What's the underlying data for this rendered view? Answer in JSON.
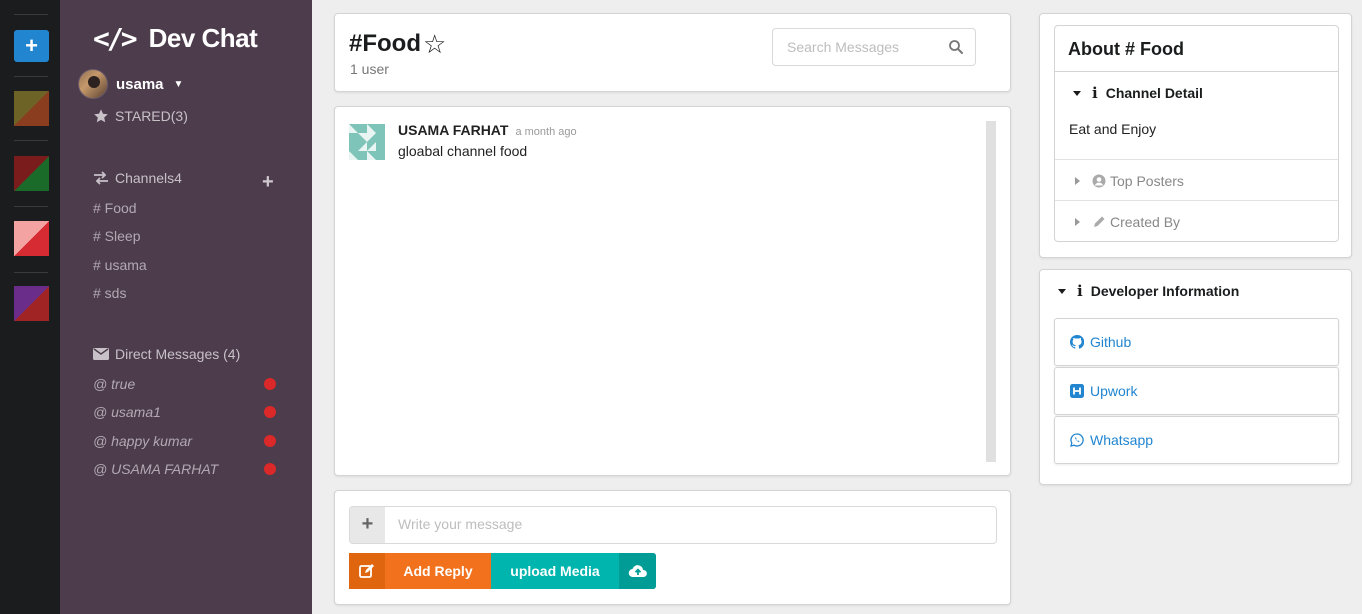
{
  "app": {
    "brand_code": "</>",
    "brand_name": "Dev Chat"
  },
  "rail": {
    "add_label": "+"
  },
  "user": {
    "name": "usama"
  },
  "sidebar": {
    "starred_label": "STARED(3)",
    "channels_label": "Channels4",
    "channels": [
      "# Food",
      "# Sleep",
      "# usama",
      "# sds"
    ],
    "direct_label": "Direct Messages (4)",
    "direct_messages": [
      "@ true",
      "@ usama1",
      "@ happy kumar",
      "@ USAMA FARHAT"
    ]
  },
  "header": {
    "channel_title": "#Food",
    "user_count": "1 user",
    "search_placeholder": "Search Messages"
  },
  "messages": [
    {
      "author": "USAMA FARHAT",
      "time": "a month ago",
      "text": "gloabal channel food"
    }
  ],
  "composer": {
    "plus_label": "+",
    "placeholder": "Write your message",
    "reply_label": "Add Reply",
    "upload_label": "upload Media"
  },
  "about": {
    "title": "About # Food",
    "channel_detail_label": "Channel Detail",
    "channel_detail_text": "Eat and Enjoy",
    "top_posters_label": "Top Posters",
    "created_by_label": "Created By"
  },
  "developer": {
    "label": "Developer Information",
    "links": [
      "Github",
      "Upwork",
      "Whatsapp"
    ]
  },
  "colors": {
    "sidebar_bg": "#4c3c4c",
    "rail_bg": "#1b1c1d",
    "accent_blue": "#2185d0",
    "reply_orange": "#f2711c",
    "upload_teal": "#00b5ad",
    "status_red": "#db2828"
  }
}
